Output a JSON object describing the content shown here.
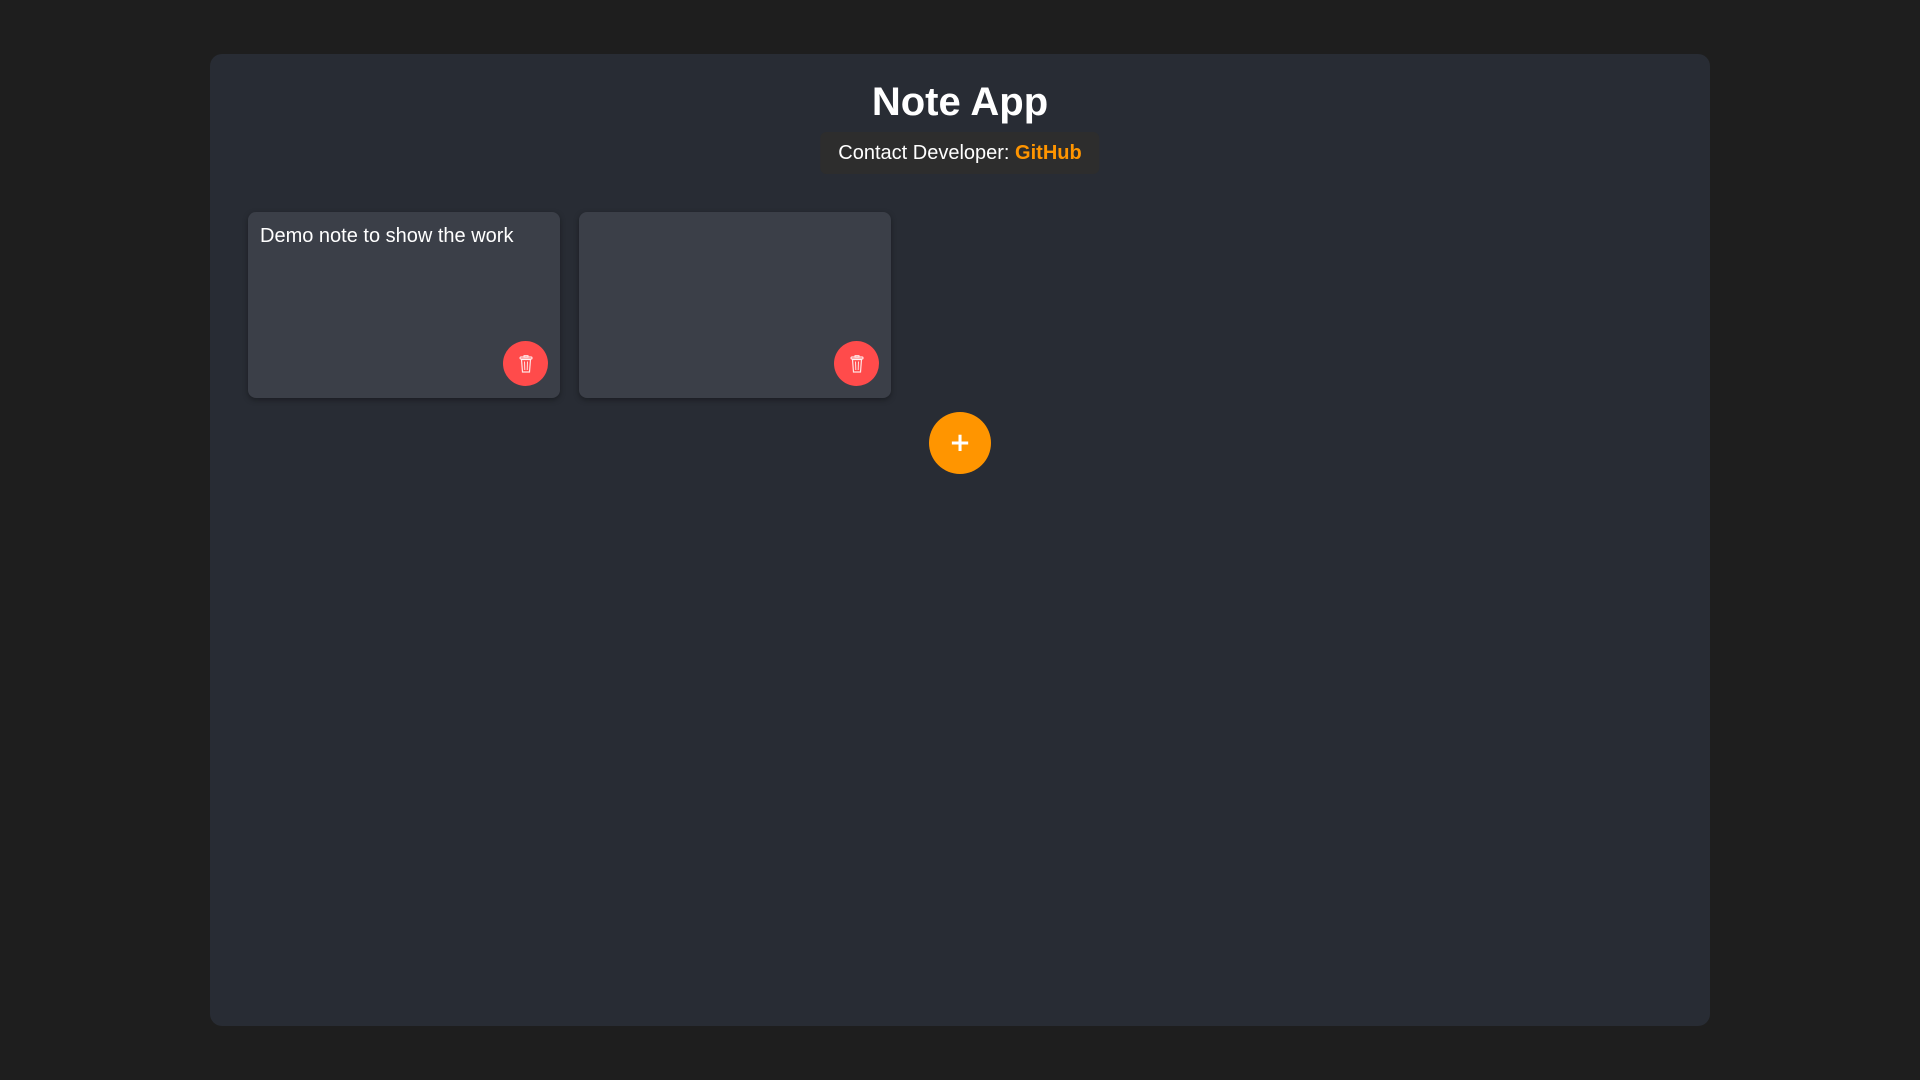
{
  "app": {
    "title": "Note App"
  },
  "contact": {
    "label": "Contact Developer:",
    "link_text": "GitHub"
  },
  "notes": [
    {
      "text": "Demo note to show the work"
    },
    {
      "text": ""
    }
  ],
  "actions": {
    "add_label": "+",
    "delete_icon": "trash-icon"
  },
  "colors": {
    "background": "#1e1e1e",
    "panel": "#282c34",
    "note_card": "#3b3f48",
    "accent": "#ff9500",
    "delete": "#ff4b4b"
  }
}
